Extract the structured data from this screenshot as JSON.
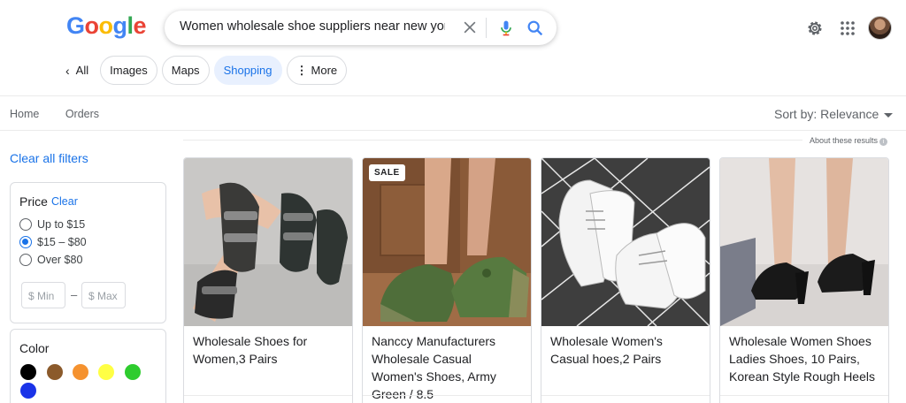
{
  "header": {
    "logo_letters": [
      {
        "ch": "G",
        "color": "#4285F4"
      },
      {
        "ch": "o",
        "color": "#EA4335"
      },
      {
        "ch": "o",
        "color": "#FBBC05"
      },
      {
        "ch": "g",
        "color": "#4285F4"
      },
      {
        "ch": "l",
        "color": "#34A853"
      },
      {
        "ch": "e",
        "color": "#EA4335"
      }
    ],
    "search_query": "Women wholesale shoe suppliers near new york ny usa"
  },
  "tabs": [
    {
      "label": "All",
      "icon": "chevron-left-icon"
    },
    {
      "label": "Images"
    },
    {
      "label": "Maps"
    },
    {
      "label": "Shopping",
      "active": true
    },
    {
      "label": "More",
      "icon": "vertical-dots-icon"
    }
  ],
  "subnav": {
    "home": "Home",
    "orders": "Orders"
  },
  "sort": {
    "label": "Sort by: Relevance"
  },
  "about": "About these results",
  "sidebar": {
    "clear_all": "Clear all filters",
    "price": {
      "title": "Price",
      "clear": "Clear",
      "options": [
        "Up to $15",
        "$15 – $80",
        "Over $80"
      ],
      "selected_index": 1,
      "min_placeholder": "$ Min",
      "max_placeholder": "$ Max",
      "separator": "–"
    },
    "color": {
      "title": "Color",
      "swatches": [
        "#000000",
        "#8B5A2B",
        "#F5922F",
        "#FFFF44",
        "#2ECC2E",
        "#1A33E8"
      ]
    }
  },
  "products": [
    {
      "title": "Wholesale Shoes for Women,3 Pairs"
    },
    {
      "title": "Nanccy Manufacturers Wholesale Casual Women's Shoes, Army Green / 8.5",
      "badge": "SALE"
    },
    {
      "title": "Wholesale Women's Casual hoes,2 Pairs"
    },
    {
      "title": "Wholesale Women Shoes Ladies Shoes, 10 Pairs, Korean Style Rough Heels"
    }
  ],
  "colors": {
    "accent": "#1a73e8",
    "active_tab_bg": "#e8f0fe"
  }
}
